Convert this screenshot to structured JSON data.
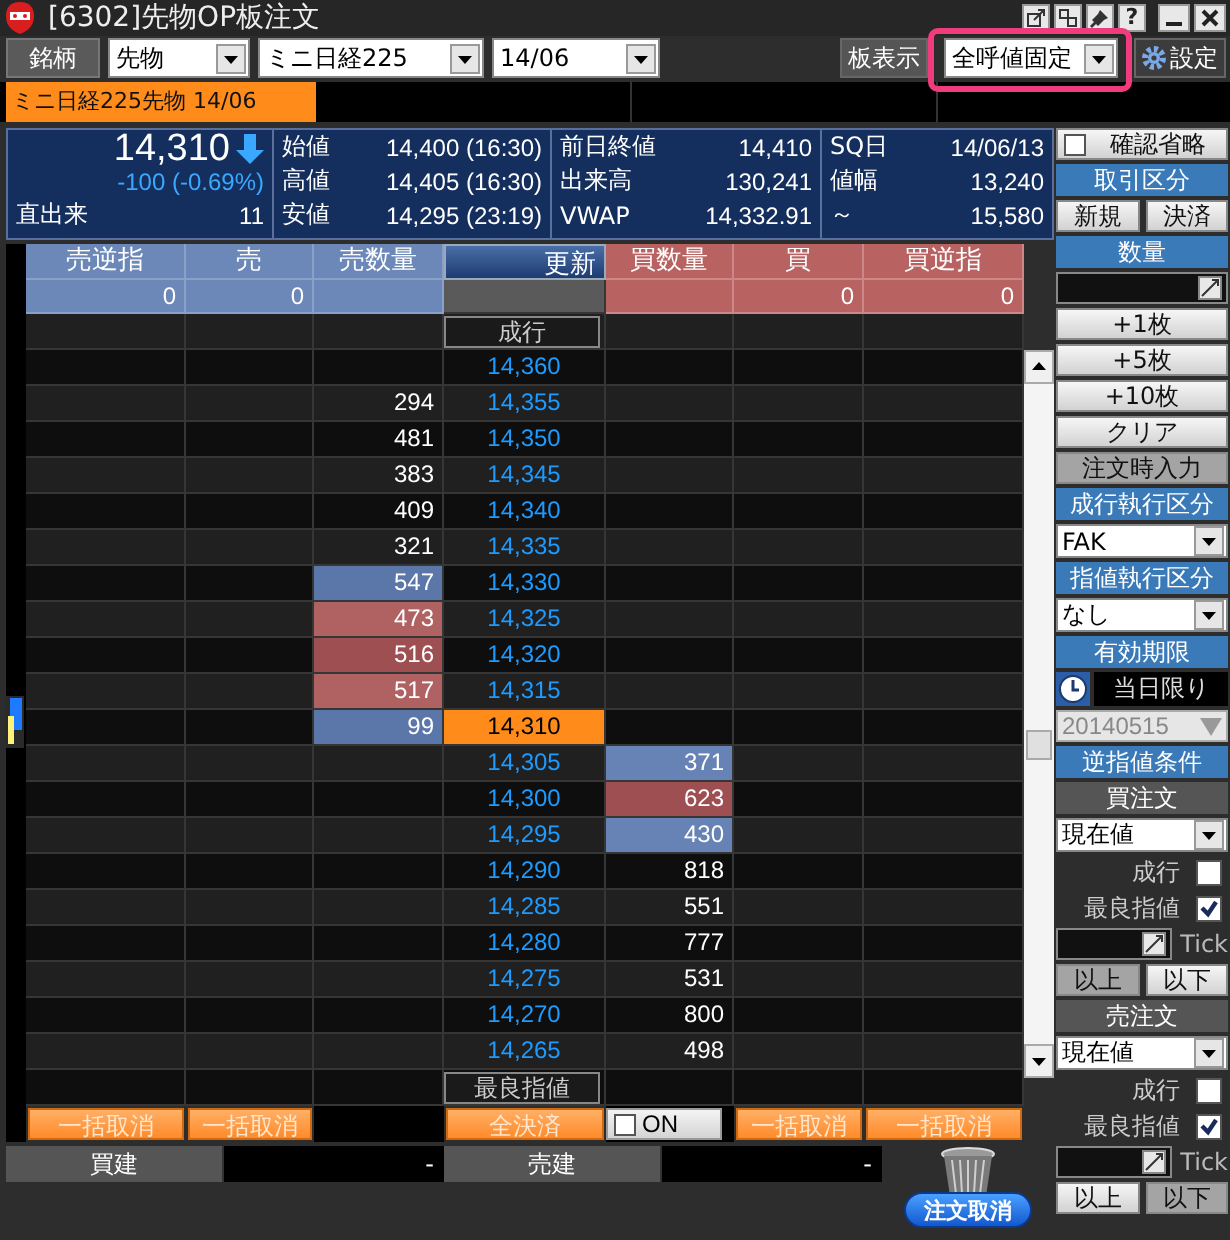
{
  "window": {
    "title": "[6302]先物OP板注文",
    "help_button": "?"
  },
  "toolbar": {
    "symbol_button": "銘柄",
    "selects": [
      {
        "value": "先物"
      },
      {
        "value": "ミニ日経225"
      },
      {
        "value": "14/06"
      }
    ],
    "board_display_label": "板表示",
    "board_display": {
      "value": "全呼値固定",
      "highlighted": true
    },
    "settings_button": "設定"
  },
  "tabs": [
    {
      "label": "ミニ日経225先物 14/06",
      "selected": true
    }
  ],
  "quote": {
    "price": "14,310",
    "arrow": {
      "kind": "down"
    },
    "change": "-100 (-0.69%)",
    "last_volume_label": "直出来",
    "last_volume": "11",
    "stats": [
      [
        {
          "label": "始値",
          "value": "14,400 (16:30)"
        },
        {
          "label": "高値",
          "value": "14,405 (16:30)"
        },
        {
          "label": "安値",
          "value": "14,295 (23:19)"
        }
      ],
      [
        {
          "label": "前日終値",
          "value": "14,410"
        },
        {
          "label": "出来高",
          "value": "130,241"
        },
        {
          "label": "VWAP",
          "value": "14,332.91"
        }
      ],
      [
        {
          "label": "SQ日",
          "value": "14/06/13"
        },
        {
          "label": "値幅",
          "value": "13,240"
        },
        {
          "label": "～",
          "value": "15,580"
        }
      ]
    ]
  },
  "board": {
    "columns": [
      {
        "label": "売逆指",
        "kind": "sell"
      },
      {
        "label": "売",
        "kind": "sell"
      },
      {
        "label": "売数量",
        "kind": "sell"
      },
      {
        "label": "更新",
        "kind": "center"
      },
      {
        "label": "買数量",
        "kind": "buy"
      },
      {
        "label": "買",
        "kind": "buy"
      },
      {
        "label": "買逆指",
        "kind": "buy"
      }
    ],
    "totals": {
      "sell_stop": "0",
      "sell": "0",
      "buy": "0",
      "buy_stop": "0"
    },
    "market_order_label": "成行",
    "best_limit_label": "最良指値",
    "rows": [
      {
        "price": "14,360",
        "current": false
      },
      {
        "price": "14,355",
        "sell": {
          "qty": "294"
        },
        "current": false
      },
      {
        "price": "14,350",
        "sell": {
          "qty": "481"
        },
        "current": false
      },
      {
        "price": "14,345",
        "sell": {
          "qty": "383"
        },
        "current": false
      },
      {
        "price": "14,340",
        "sell": {
          "qty": "409"
        },
        "current": false
      },
      {
        "price": "14,335",
        "sell": {
          "qty": "321"
        },
        "current": false
      },
      {
        "price": "14,330",
        "sell": {
          "qty": "547",
          "color": "#5b76a8"
        },
        "current": false
      },
      {
        "price": "14,325",
        "sell": {
          "qty": "473",
          "color": "#b06262"
        },
        "current": false
      },
      {
        "price": "14,320",
        "sell": {
          "qty": "516",
          "color": "#9e4f52"
        },
        "current": false
      },
      {
        "price": "14,315",
        "sell": {
          "qty": "517",
          "color": "#b06262"
        },
        "current": false
      },
      {
        "price": "14,310",
        "sell": {
          "qty": "99",
          "color": "#5b76a8"
        },
        "current": true
      },
      {
        "price": "14,305",
        "buy": {
          "qty": "371",
          "color": "#6783b5"
        },
        "current": false
      },
      {
        "price": "14,300",
        "buy": {
          "qty": "623",
          "color": "#9e4f52"
        },
        "current": false
      },
      {
        "price": "14,295",
        "buy": {
          "qty": "430",
          "color": "#6783b5"
        },
        "current": false
      },
      {
        "price": "14,290",
        "buy": {
          "qty": "818"
        },
        "current": false
      },
      {
        "price": "14,285",
        "buy": {
          "qty": "551"
        },
        "current": false
      },
      {
        "price": "14,280",
        "buy": {
          "qty": "777"
        },
        "current": false
      },
      {
        "price": "14,275",
        "buy": {
          "qty": "531"
        },
        "current": false
      },
      {
        "price": "14,270",
        "buy": {
          "qty": "800"
        },
        "current": false
      },
      {
        "price": "14,265",
        "buy": {
          "qty": "498"
        },
        "current": false
      }
    ],
    "bottom_buttons": {
      "sell_stop_cancel": "一括取消",
      "sell_cancel": "一括取消",
      "close_all": "全決済",
      "on_toggle": {
        "label": "ON",
        "checked": false
      },
      "buy_cancel": "一括取消",
      "buy_stop_cancel": "一括取消"
    }
  },
  "positions": [
    {
      "label": "買建",
      "value": "-"
    },
    {
      "label": "売建",
      "value": "-"
    }
  ],
  "cancel_order_button": "注文取消",
  "side_panel": [
    {
      "kind": "checkbox",
      "label": "確認省略",
      "checked": false
    },
    {
      "kind": "header",
      "label": "取引区分"
    },
    {
      "kind": "pair",
      "buttons": [
        {
          "label": "新規",
          "selected": false
        },
        {
          "label": "決済",
          "selected": false
        }
      ]
    },
    {
      "kind": "header",
      "label": "数量"
    },
    {
      "kind": "number_input"
    },
    {
      "kind": "button",
      "label": "+1枚",
      "pressed": false
    },
    {
      "kind": "button",
      "label": "+5枚",
      "pressed": false
    },
    {
      "kind": "button",
      "label": "+10枚",
      "pressed": false
    },
    {
      "kind": "button",
      "label": "クリア",
      "pressed": false
    },
    {
      "kind": "button",
      "label": "注文時入力",
      "pressed": true
    },
    {
      "kind": "header",
      "label": "成行執行区分"
    },
    {
      "kind": "select",
      "value": "FAK"
    },
    {
      "kind": "header",
      "label": "指値執行区分"
    },
    {
      "kind": "select",
      "value": "なし"
    },
    {
      "kind": "header",
      "label": "有効期限"
    },
    {
      "kind": "expiry",
      "value": "当日限り"
    },
    {
      "kind": "date",
      "value": "20140515",
      "disabled": true
    },
    {
      "kind": "header",
      "label": "逆指値条件"
    },
    {
      "kind": "subheader",
      "label": "買注文"
    },
    {
      "kind": "select",
      "value": "現在値"
    },
    {
      "kind": "check_row",
      "label": "成行",
      "checked": false
    },
    {
      "kind": "check_row",
      "label": "最良指値",
      "checked": true
    },
    {
      "kind": "tick_input",
      "unit": "Tick"
    },
    {
      "kind": "pair",
      "buttons": [
        {
          "label": "以上",
          "selected": true
        },
        {
          "label": "以下",
          "selected": false
        }
      ]
    },
    {
      "kind": "subheader",
      "label": "売注文"
    },
    {
      "kind": "select",
      "value": "現在値"
    },
    {
      "kind": "check_row",
      "label": "成行",
      "checked": false
    },
    {
      "kind": "check_row",
      "label": "最良指値",
      "checked": true
    },
    {
      "kind": "tick_input",
      "unit": "Tick"
    },
    {
      "kind": "pair",
      "buttons": [
        {
          "label": "以上",
          "selected": false
        },
        {
          "label": "以下",
          "selected": true
        }
      ]
    }
  ]
}
